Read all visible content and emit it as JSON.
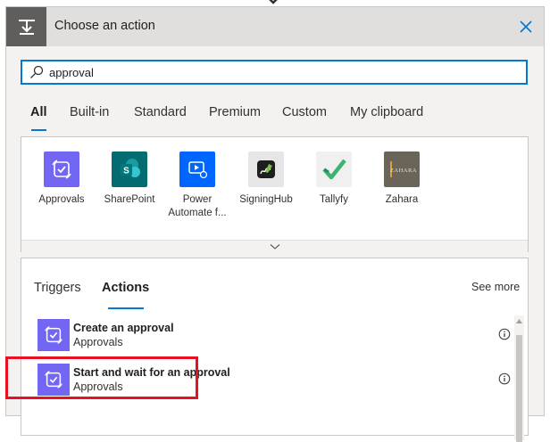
{
  "header": {
    "title": "Choose an action"
  },
  "search": {
    "value": "approval"
  },
  "tabs": [
    {
      "label": "All",
      "active": true
    },
    {
      "label": "Built-in"
    },
    {
      "label": "Standard"
    },
    {
      "label": "Premium"
    },
    {
      "label": "Custom"
    },
    {
      "label": "My clipboard"
    }
  ],
  "connectors": [
    {
      "label": "Approvals",
      "icon": "approvals-icon",
      "color": "#7266f2"
    },
    {
      "label": "SharePoint",
      "icon": "sharepoint-icon",
      "color": "#036c70"
    },
    {
      "label": "Power Automate f...",
      "label_line1": "Power",
      "label_line2": "Automate f...",
      "icon": "power-automate-icon",
      "color": "#0066ff"
    },
    {
      "label": "SigningHub",
      "icon": "signinghub-icon",
      "color": "#e6e6e6"
    },
    {
      "label": "Tallyfy",
      "icon": "tallyfy-icon",
      "color": "#f0f0f0"
    },
    {
      "label": "Zahara",
      "icon": "zahara-icon",
      "color": "#6b6459"
    }
  ],
  "lower": {
    "tabs": [
      {
        "label": "Triggers"
      },
      {
        "label": "Actions",
        "active": true
      }
    ],
    "see_more": "See more",
    "actions": [
      {
        "title": "Create an approval",
        "subtitle": "Approvals"
      },
      {
        "title": "Start and wait for an approval",
        "subtitle": "Approvals",
        "highlighted": true
      }
    ]
  },
  "colors": {
    "accent": "#0078d4",
    "highlight": "#e81123",
    "approvals": "#7266f2"
  }
}
